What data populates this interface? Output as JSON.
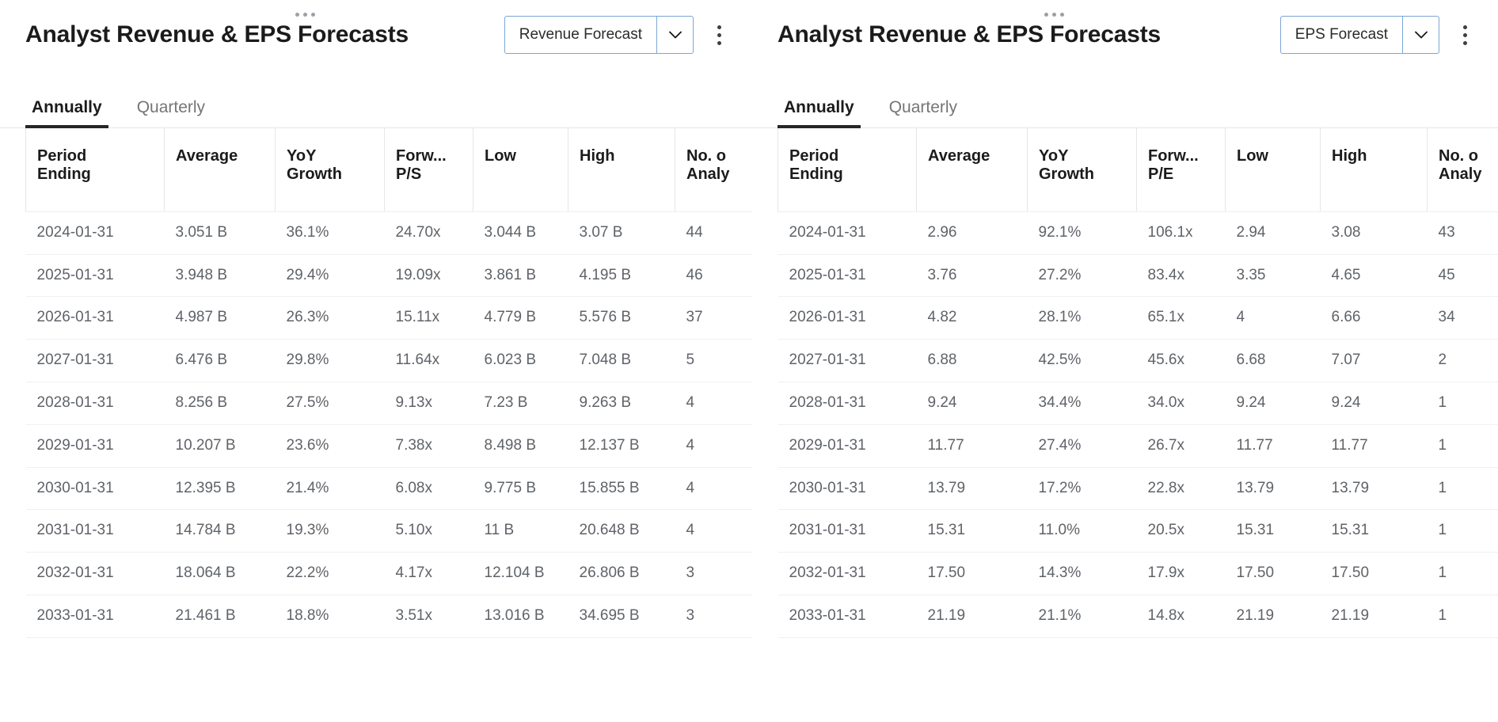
{
  "panels": [
    {
      "title": "Analyst Revenue & EPS Forecasts",
      "drag_handle_icon": "drag-dots-horizontal-icon",
      "select": {
        "value": "Revenue Forecast",
        "arrow_icon": "chevron-down-icon",
        "options": [
          "Revenue Forecast",
          "EPS Forecast"
        ]
      },
      "menu_icon": "kebab-menu-icon",
      "tabs": [
        {
          "label": "Annually",
          "active": true
        },
        {
          "label": "Quarterly",
          "active": false
        }
      ],
      "table": {
        "columns": [
          "Period\nEnding",
          "Average",
          "YoY\nGrowth",
          "Forw...\nP/S",
          "Low",
          "High",
          "No. o\nAnaly"
        ],
        "rows": [
          [
            "2024-01-31",
            "3.051 B",
            "36.1%",
            "24.70x",
            "3.044 B",
            "3.07 B",
            "44"
          ],
          [
            "2025-01-31",
            "3.948 B",
            "29.4%",
            "19.09x",
            "3.861 B",
            "4.195 B",
            "46"
          ],
          [
            "2026-01-31",
            "4.987 B",
            "26.3%",
            "15.11x",
            "4.779 B",
            "5.576 B",
            "37"
          ],
          [
            "2027-01-31",
            "6.476 B",
            "29.8%",
            "11.64x",
            "6.023 B",
            "7.048 B",
            "5"
          ],
          [
            "2028-01-31",
            "8.256 B",
            "27.5%",
            "9.13x",
            "7.23 B",
            "9.263 B",
            "4"
          ],
          [
            "2029-01-31",
            "10.207 B",
            "23.6%",
            "7.38x",
            "8.498 B",
            "12.137 B",
            "4"
          ],
          [
            "2030-01-31",
            "12.395 B",
            "21.4%",
            "6.08x",
            "9.775 B",
            "15.855 B",
            "4"
          ],
          [
            "2031-01-31",
            "14.784 B",
            "19.3%",
            "5.10x",
            "11 B",
            "20.648 B",
            "4"
          ],
          [
            "2032-01-31",
            "18.064 B",
            "22.2%",
            "4.17x",
            "12.104 B",
            "26.806 B",
            "3"
          ],
          [
            "2033-01-31",
            "21.461 B",
            "18.8%",
            "3.51x",
            "13.016 B",
            "34.695 B",
            "3"
          ]
        ]
      }
    },
    {
      "title": "Analyst Revenue & EPS Forecasts",
      "drag_handle_icon": "drag-dots-horizontal-icon",
      "select": {
        "value": "EPS Forecast",
        "arrow_icon": "chevron-down-icon",
        "options": [
          "Revenue Forecast",
          "EPS Forecast"
        ]
      },
      "menu_icon": "kebab-menu-icon",
      "tabs": [
        {
          "label": "Annually",
          "active": true
        },
        {
          "label": "Quarterly",
          "active": false
        }
      ],
      "table": {
        "columns": [
          "Period\nEnding",
          "Average",
          "YoY\nGrowth",
          "Forw...\nP/E",
          "Low",
          "High",
          "No. o\nAnaly"
        ],
        "rows": [
          [
            "2024-01-31",
            "2.96",
            "92.1%",
            "106.1x",
            "2.94",
            "3.08",
            "43"
          ],
          [
            "2025-01-31",
            "3.76",
            "27.2%",
            "83.4x",
            "3.35",
            "4.65",
            "45"
          ],
          [
            "2026-01-31",
            "4.82",
            "28.1%",
            "65.1x",
            "4",
            "6.66",
            "34"
          ],
          [
            "2027-01-31",
            "6.88",
            "42.5%",
            "45.6x",
            "6.68",
            "7.07",
            "2"
          ],
          [
            "2028-01-31",
            "9.24",
            "34.4%",
            "34.0x",
            "9.24",
            "9.24",
            "1"
          ],
          [
            "2029-01-31",
            "11.77",
            "27.4%",
            "26.7x",
            "11.77",
            "11.77",
            "1"
          ],
          [
            "2030-01-31",
            "13.79",
            "17.2%",
            "22.8x",
            "13.79",
            "13.79",
            "1"
          ],
          [
            "2031-01-31",
            "15.31",
            "11.0%",
            "20.5x",
            "15.31",
            "15.31",
            "1"
          ],
          [
            "2032-01-31",
            "17.50",
            "14.3%",
            "17.9x",
            "17.50",
            "17.50",
            "1"
          ],
          [
            "2033-01-31",
            "21.19",
            "21.1%",
            "14.8x",
            "21.19",
            "21.19",
            "1"
          ]
        ]
      }
    }
  ],
  "colors": {
    "select_border": "#7ba7d7",
    "tab_active_underline": "#262626",
    "title_text": "#1b1b1b",
    "cell_text": "#5f6368",
    "row_divider": "#eff0f1"
  }
}
